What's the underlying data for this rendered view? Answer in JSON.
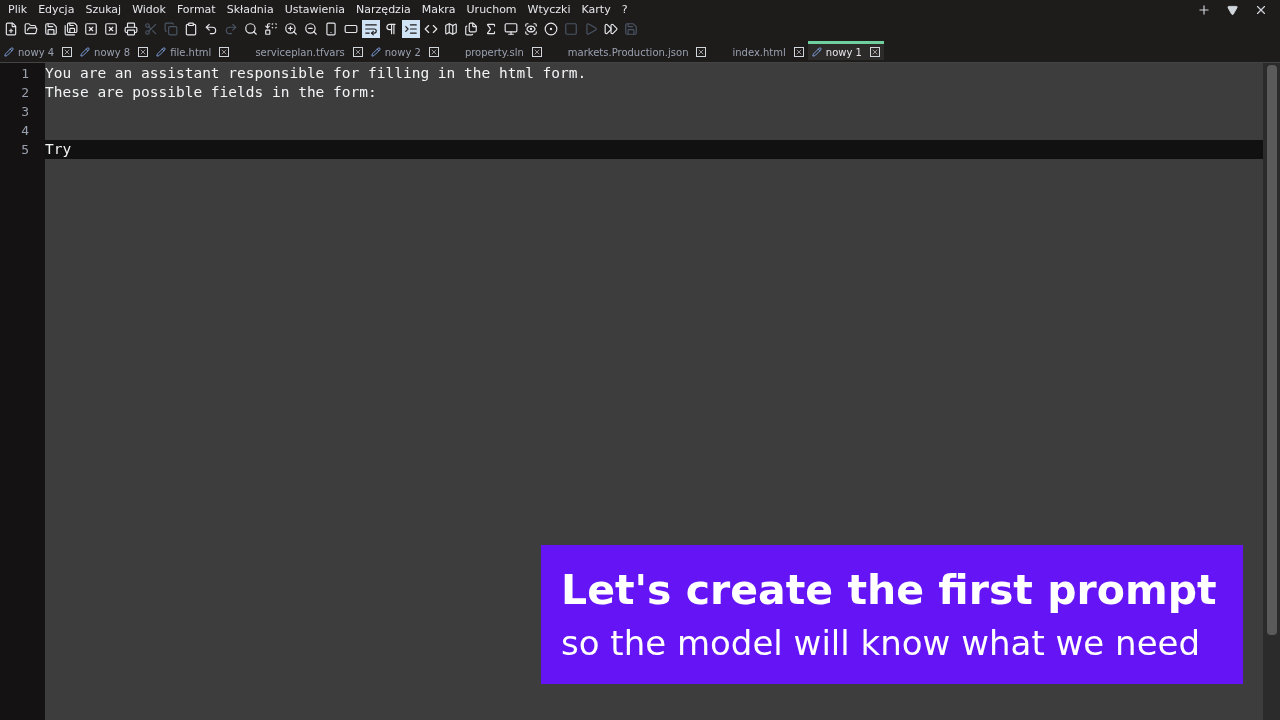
{
  "menu": [
    "Plik",
    "Edycja",
    "Szukaj",
    "Widok",
    "Format",
    "Składnia",
    "Ustawienia",
    "Narzędzia",
    "Makra",
    "Uruchom",
    "Wtyczki",
    "Karty",
    "?"
  ],
  "window_controls": [
    {
      "kind": "add"
    },
    {
      "kind": "dropdown"
    },
    {
      "kind": "close"
    }
  ],
  "toolbar": [
    {
      "kind": "new",
      "active": false,
      "disabled": false
    },
    {
      "kind": "open",
      "active": false,
      "disabled": false
    },
    {
      "kind": "save",
      "active": false,
      "disabled": false
    },
    {
      "kind": "save_all",
      "active": false,
      "disabled": false
    },
    {
      "kind": "close",
      "active": false,
      "disabled": false
    },
    {
      "kind": "close_all",
      "active": false,
      "disabled": false
    },
    {
      "kind": "print",
      "active": false,
      "disabled": false
    },
    {
      "kind": "cut",
      "active": false,
      "disabled": true
    },
    {
      "kind": "copy",
      "active": false,
      "disabled": true
    },
    {
      "kind": "paste",
      "active": false,
      "disabled": false
    },
    {
      "kind": "undo",
      "active": false,
      "disabled": false
    },
    {
      "kind": "redo",
      "active": false,
      "disabled": true
    },
    {
      "kind": "find",
      "active": false,
      "disabled": false
    },
    {
      "kind": "replace",
      "active": false,
      "disabled": false
    },
    {
      "kind": "zoom_in",
      "active": false,
      "disabled": false
    },
    {
      "kind": "zoom_out",
      "active": false,
      "disabled": false
    },
    {
      "kind": "sync_v",
      "active": false,
      "disabled": false
    },
    {
      "kind": "sync_h",
      "active": false,
      "disabled": false
    },
    {
      "kind": "wrap",
      "active": true,
      "disabled": false
    },
    {
      "kind": "pilcrow",
      "active": false,
      "disabled": false
    },
    {
      "kind": "indent",
      "active": true,
      "disabled": false
    },
    {
      "kind": "code",
      "active": false,
      "disabled": false
    },
    {
      "kind": "map",
      "active": false,
      "disabled": false
    },
    {
      "kind": "files",
      "active": false,
      "disabled": false
    },
    {
      "kind": "function",
      "active": false,
      "disabled": false
    },
    {
      "kind": "monitor",
      "active": false,
      "disabled": false
    },
    {
      "kind": "watch",
      "active": false,
      "disabled": false
    },
    {
      "kind": "record",
      "active": false,
      "disabled": false
    },
    {
      "kind": "stop",
      "active": false,
      "disabled": true
    },
    {
      "kind": "play",
      "active": false,
      "disabled": true
    },
    {
      "kind": "play_multi",
      "active": false,
      "disabled": false
    },
    {
      "kind": "save_macro",
      "active": false,
      "disabled": true
    }
  ],
  "tabs": [
    {
      "label": "nowy 4",
      "modified": true,
      "selected": false
    },
    {
      "label": "nowy 8",
      "modified": true,
      "selected": false
    },
    {
      "label": "file.html",
      "modified": true,
      "selected": false
    },
    {
      "label": "serviceplan.tfvars",
      "modified": false,
      "selected": false
    },
    {
      "label": "nowy 2",
      "modified": true,
      "selected": false
    },
    {
      "label": "property.sln",
      "modified": false,
      "selected": false
    },
    {
      "label": "markets.Production.json",
      "modified": false,
      "selected": false
    },
    {
      "label": "index.html",
      "modified": false,
      "selected": false
    },
    {
      "label": "nowy 1",
      "modified": true,
      "selected": true
    }
  ],
  "editor": {
    "lines": [
      {
        "number": "1",
        "text": "You are an assistant responsible for filling in the html form.",
        "current": false
      },
      {
        "number": "2",
        "text": "These are possible fields in the form:",
        "current": false
      },
      {
        "number": "3",
        "current": false
      },
      {
        "number": "4",
        "current": false
      },
      {
        "number": "5",
        "text": "Try",
        "current": true
      }
    ]
  },
  "caption": {
    "title": "Let's create the first prompt",
    "subtitle": "so the model will know what we need"
  }
}
